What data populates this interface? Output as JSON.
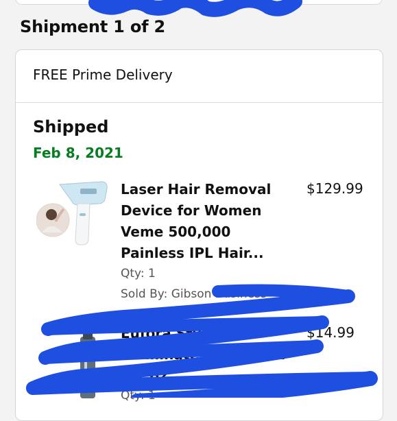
{
  "shipment": {
    "heading": "Shipment 1 of 2"
  },
  "delivery": {
    "label": "FREE Prime Delivery"
  },
  "status": {
    "title": "Shipped",
    "date": "Feb 8, 2021"
  },
  "items": [
    {
      "title": "Laser Hair Removal Device for Women Veme 500,000 Painless IPL Hair...",
      "price": "$129.99",
      "qty": "Qty: 1",
      "sold_by": "Sold By: Gibson Business"
    },
    {
      "title": "Eufora Style Illuminate Shine Mist 5.1 oz",
      "price": "$14.99",
      "qty": "Qty: 1"
    }
  ],
  "colors": {
    "background": "#f3f3f3",
    "card": "#ffffff",
    "date_green": "#067d20",
    "redaction_blue": "#1f4fe0"
  }
}
